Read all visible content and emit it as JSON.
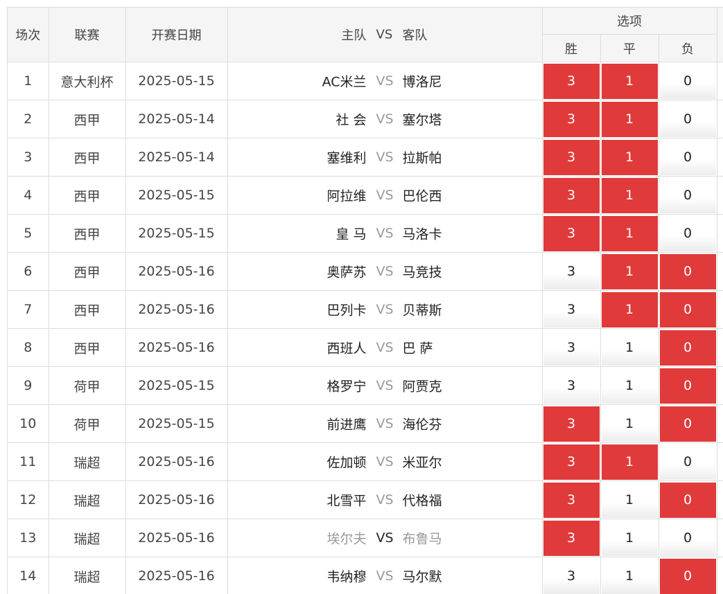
{
  "header": {
    "round": "场次",
    "league": "联赛",
    "date": "开赛日期",
    "home": "主队",
    "vs": "VS",
    "away": "客队",
    "options": "选项",
    "win": "胜",
    "draw": "平",
    "loss": "负"
  },
  "colors": {
    "selected": "#e03a3a",
    "unselected": "#ffffff"
  },
  "rows": [
    {
      "no": "1",
      "league": "意大利杯",
      "date": "2025-05-15",
      "home": "AC米兰",
      "vs": "VS",
      "away": "博洛尼",
      "win": "3",
      "draw": "1",
      "loss": "0",
      "sel": [
        true,
        true,
        false
      ],
      "muted": false
    },
    {
      "no": "2",
      "league": "西甲",
      "date": "2025-05-14",
      "home": "社 会",
      "vs": "VS",
      "away": "塞尔塔",
      "win": "3",
      "draw": "1",
      "loss": "0",
      "sel": [
        true,
        true,
        false
      ],
      "muted": false
    },
    {
      "no": "3",
      "league": "西甲",
      "date": "2025-05-14",
      "home": "塞维利",
      "vs": "VS",
      "away": "拉斯帕",
      "win": "3",
      "draw": "1",
      "loss": "0",
      "sel": [
        true,
        true,
        false
      ],
      "muted": false
    },
    {
      "no": "4",
      "league": "西甲",
      "date": "2025-05-15",
      "home": "阿拉维",
      "vs": "VS",
      "away": "巴伦西",
      "win": "3",
      "draw": "1",
      "loss": "0",
      "sel": [
        true,
        true,
        false
      ],
      "muted": false
    },
    {
      "no": "5",
      "league": "西甲",
      "date": "2025-05-15",
      "home": "皇 马",
      "vs": "VS",
      "away": "马洛卡",
      "win": "3",
      "draw": "1",
      "loss": "0",
      "sel": [
        true,
        true,
        false
      ],
      "muted": false
    },
    {
      "no": "6",
      "league": "西甲",
      "date": "2025-05-16",
      "home": "奥萨苏",
      "vs": "VS",
      "away": "马竞技",
      "win": "3",
      "draw": "1",
      "loss": "0",
      "sel": [
        false,
        true,
        true
      ],
      "muted": false
    },
    {
      "no": "7",
      "league": "西甲",
      "date": "2025-05-16",
      "home": "巴列卡",
      "vs": "VS",
      "away": "贝蒂斯",
      "win": "3",
      "draw": "1",
      "loss": "0",
      "sel": [
        false,
        true,
        true
      ],
      "muted": false
    },
    {
      "no": "8",
      "league": "西甲",
      "date": "2025-05-16",
      "home": "西班人",
      "vs": "VS",
      "away": "巴 萨",
      "win": "3",
      "draw": "1",
      "loss": "0",
      "sel": [
        false,
        false,
        true
      ],
      "muted": false
    },
    {
      "no": "9",
      "league": "荷甲",
      "date": "2025-05-15",
      "home": "格罗宁",
      "vs": "VS",
      "away": "阿贾克",
      "win": "3",
      "draw": "1",
      "loss": "0",
      "sel": [
        false,
        false,
        true
      ],
      "muted": false
    },
    {
      "no": "10",
      "league": "荷甲",
      "date": "2025-05-15",
      "home": "前进鹰",
      "vs": "VS",
      "away": "海伦芬",
      "win": "3",
      "draw": "1",
      "loss": "0",
      "sel": [
        true,
        false,
        true
      ],
      "muted": false
    },
    {
      "no": "11",
      "league": "瑞超",
      "date": "2025-05-16",
      "home": "佐加顿",
      "vs": "VS",
      "away": "米亚尔",
      "win": "3",
      "draw": "1",
      "loss": "0",
      "sel": [
        true,
        true,
        false
      ],
      "muted": false
    },
    {
      "no": "12",
      "league": "瑞超",
      "date": "2025-05-16",
      "home": "北雪平",
      "vs": "VS",
      "away": "代格福",
      "win": "3",
      "draw": "1",
      "loss": "0",
      "sel": [
        true,
        false,
        true
      ],
      "muted": false
    },
    {
      "no": "13",
      "league": "瑞超",
      "date": "2025-05-16",
      "home": "埃尔夫",
      "vs": "VS",
      "away": "布鲁马",
      "win": "3",
      "draw": "1",
      "loss": "0",
      "sel": [
        true,
        false,
        false
      ],
      "muted": true
    },
    {
      "no": "14",
      "league": "瑞超",
      "date": "2025-05-16",
      "home": "韦纳穆",
      "vs": "VS",
      "away": "马尔默",
      "win": "3",
      "draw": "1",
      "loss": "0",
      "sel": [
        false,
        false,
        true
      ],
      "muted": false
    }
  ]
}
